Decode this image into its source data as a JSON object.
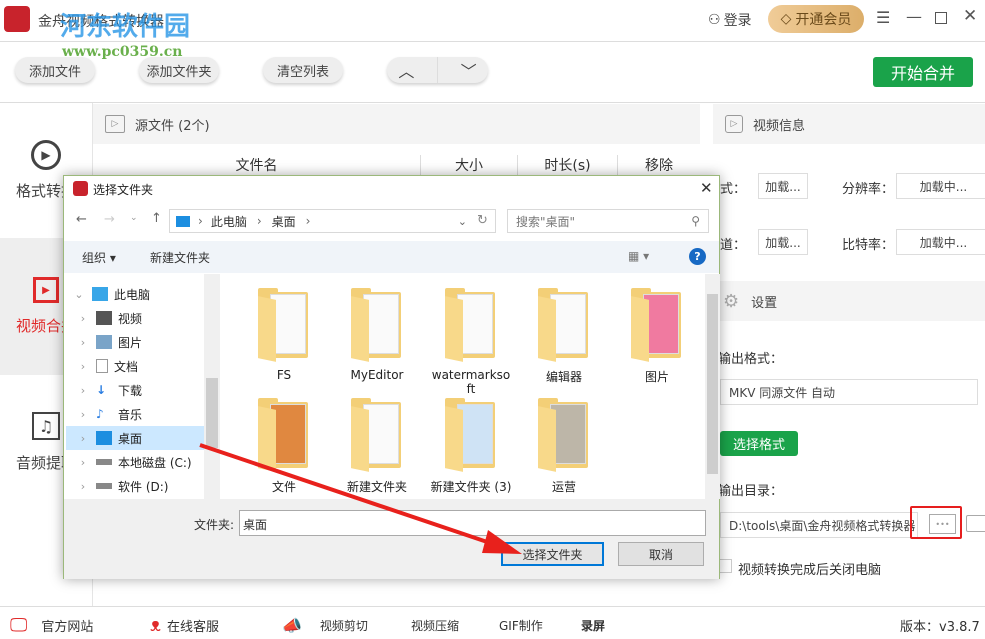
{
  "app": {
    "title": "金舟视频格式转换器",
    "watermark_name": "河东软件园",
    "watermark_url": "www.pc0359.cn",
    "login": "登录",
    "vip": "开通会员"
  },
  "toolbar": {
    "add_file": "添加文件",
    "add_folder": "添加文件夹",
    "clear_list": "清空列表",
    "start": "开始合并"
  },
  "sidebar": {
    "items": [
      {
        "label": "格式转换"
      },
      {
        "label": "视频合并"
      },
      {
        "label": "音频提取"
      }
    ]
  },
  "source": {
    "title": "源文件 (2个)",
    "columns": [
      "文件名",
      "大小",
      "时长(s)",
      "移除"
    ]
  },
  "info": {
    "title": "视频信息",
    "format_label": "格式：",
    "format_value": "加载...",
    "resolution_label": "分辨率：",
    "resolution_value": "加载中...",
    "channel_label": "声道：",
    "channel_value": "加载...",
    "bitrate_label": "比特率：",
    "bitrate_value": "加载中..."
  },
  "settings": {
    "title": "设置",
    "output_format_label": "输出格式：",
    "output_format_value": "MKV 同源文件 自动",
    "choose_format": "选择格式",
    "output_dir_label": "输出目录：",
    "output_dir_value": "D:\\tools\\桌面\\金舟视频格式转换器",
    "browse": "•••",
    "shutdown_label": "视频转换完成后关闭电脑"
  },
  "bottom": {
    "items": [
      "官方网站",
      "在线客服",
      "视频剪切",
      "视频压缩",
      "GIF制作",
      "录屏"
    ],
    "version": "版本：v3.8.7"
  },
  "dialog": {
    "title": "选择文件夹",
    "breadcrumb": [
      "此电脑",
      "桌面"
    ],
    "search_placeholder": "搜索\"桌面\"",
    "organize": "组织 ▾",
    "new_folder": "新建文件夹",
    "tree": [
      "此电脑",
      "视频",
      "图片",
      "文档",
      "下载",
      "音乐",
      "桌面",
      "本地磁盘 (C:)",
      "软件 (D:)"
    ],
    "folders": [
      "FS",
      "MyEditor",
      "watermarksoft",
      "编辑器",
      "图片",
      "文件",
      "新建文件夹",
      "新建文件夹 (3)",
      "运营"
    ],
    "folder_label": "文件夹:",
    "folder_value": "桌面",
    "select": "选择文件夹",
    "cancel": "取消"
  },
  "colors": {
    "accent_red": "#e02a2a",
    "green": "#1aa34a",
    "gold": "#e8c48a"
  }
}
